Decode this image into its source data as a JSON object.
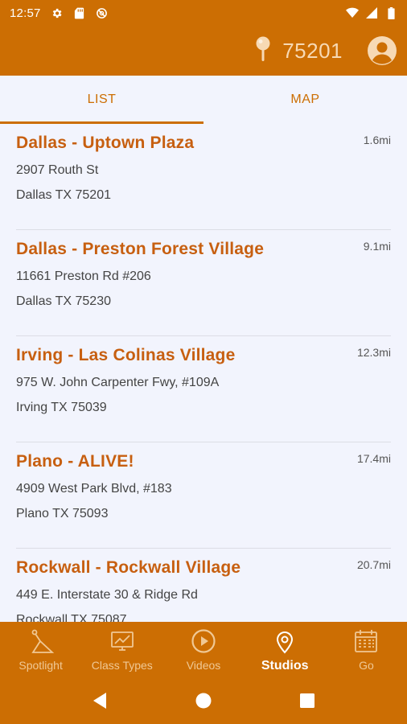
{
  "status_bar": {
    "time": "12:57",
    "icons": [
      "gear-icon",
      "sd-card-icon",
      "do-not-disturb-icon",
      "wifi-icon",
      "signal-icon",
      "battery-icon"
    ]
  },
  "app_bar": {
    "zip": "75201",
    "icons": [
      "location-pin-icon",
      "account-icon"
    ]
  },
  "tabs": [
    {
      "label": "LIST",
      "active": true
    },
    {
      "label": "MAP",
      "active": false
    }
  ],
  "studios": [
    {
      "name": "Dallas - Uptown Plaza",
      "distance": "1.6mi",
      "address": "2907 Routh St",
      "city": "Dallas TX 75201"
    },
    {
      "name": "Dallas - Preston Forest Village",
      "distance": "9.1mi",
      "address": "11661 Preston Rd #206",
      "city": "Dallas TX 75230"
    },
    {
      "name": "Irving - Las Colinas Village",
      "distance": "12.3mi",
      "address": "975 W. John Carpenter Fwy, #109A",
      "city": "Irving TX 75039"
    },
    {
      "name": "Plano - ALIVE!",
      "distance": "17.4mi",
      "address": "4909 West Park Blvd, #183",
      "city": "Plano TX 75093"
    },
    {
      "name": "Rockwall - Rockwall Village",
      "distance": "20.7mi",
      "address": "449 E. Interstate 30 & Ridge Rd",
      "city": "Rockwall TX 75087"
    }
  ],
  "bottom_nav": [
    {
      "label": "Spotlight",
      "icon": "spotlight-icon",
      "active": false
    },
    {
      "label": "Class Types",
      "icon": "class-types-icon",
      "active": false
    },
    {
      "label": "Videos",
      "icon": "play-icon",
      "active": false
    },
    {
      "label": "Studios",
      "icon": "location-pin-icon",
      "active": true
    },
    {
      "label": "Go",
      "icon": "calendar-icon",
      "active": false
    }
  ],
  "system_nav": [
    "back-icon",
    "home-icon",
    "recents-icon"
  ],
  "colors": {
    "brand_orange": "#cc6e03",
    "title_orange": "#c75f10",
    "background": "#f2f4fd"
  }
}
